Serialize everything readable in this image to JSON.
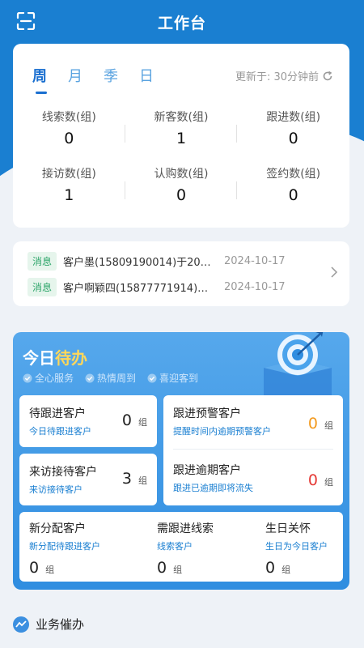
{
  "header": {
    "title": "工作台",
    "menu_icon": "scan-icon"
  },
  "stats": {
    "tabs": [
      "周",
      "月",
      "季",
      "日"
    ],
    "active_tab": 0,
    "updated_label": "更新于: 30分钟前",
    "rows": [
      [
        {
          "label": "线索数(组)",
          "value": "0"
        },
        {
          "label": "新客数(组)",
          "value": "1"
        },
        {
          "label": "跟进数(组)",
          "value": "0"
        }
      ],
      [
        {
          "label": "接访数(组)",
          "value": "1"
        },
        {
          "label": "认购数(组)",
          "value": "0"
        },
        {
          "label": "签约数(组)",
          "value": "0"
        }
      ]
    ]
  },
  "messages": [
    {
      "tag": "消息",
      "text": "客户墨(15809190014)于20…",
      "date": "2024-10-17"
    },
    {
      "tag": "消息",
      "text": "客户啊颖四(15877771914)…",
      "date": "2024-10-17"
    }
  ],
  "todo": {
    "title_prefix": "今日",
    "title_highlight": "待办",
    "tags": [
      "全心服务",
      "热情周到",
      "喜迎客到"
    ],
    "cards": {
      "follow": {
        "title": "待跟进客户",
        "sub": "今日待跟进客户",
        "value": "0",
        "unit": "组"
      },
      "visit": {
        "title": "来访接待客户",
        "sub": "来访接待客户",
        "value": "3",
        "unit": "组"
      },
      "warning": {
        "title": "跟进预警客户",
        "sub": "提醒时间内逾期预警客户",
        "value": "0",
        "unit": "组",
        "color": "#f39a1e"
      },
      "overdue": {
        "title": "跟进逾期客户",
        "sub": "跟进已逾期即将流失",
        "value": "0",
        "unit": "组",
        "color": "#e53935"
      },
      "new_assign": {
        "title": "新分配客户",
        "sub": "新分配待跟进客户",
        "value": "0",
        "unit": "组"
      },
      "leads": {
        "title": "需跟进线索",
        "sub": "线索客户",
        "value": "0",
        "unit": "组"
      },
      "birthday": {
        "title": "生日关怀",
        "sub": "生日为今日客户",
        "value": "0",
        "unit": "组"
      }
    }
  },
  "footer": {
    "section_title": "业务催办"
  }
}
